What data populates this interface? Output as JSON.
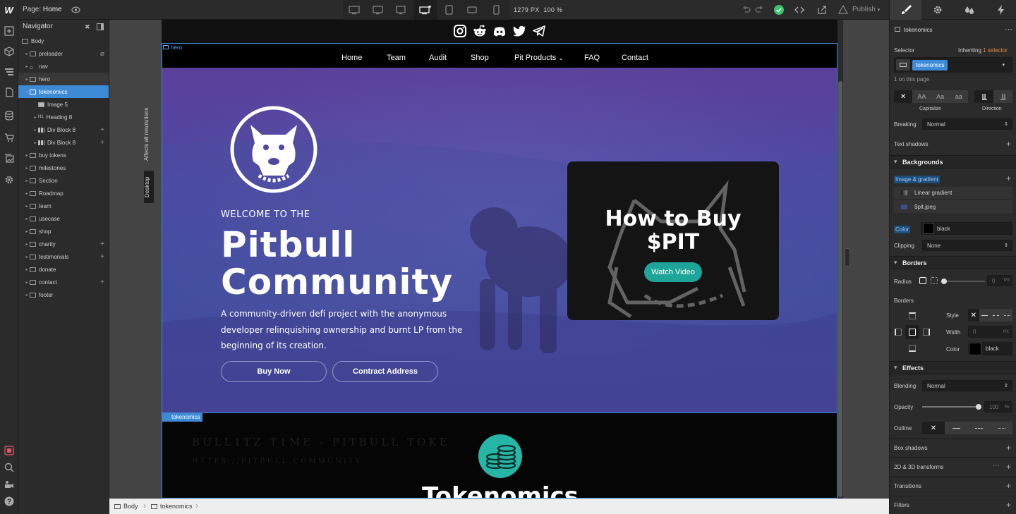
{
  "topbar": {
    "logo": "W",
    "page_prefix": "Page:",
    "page_name": "Home",
    "width_px": "1279 PX",
    "zoom": "100 %",
    "publish": "Publish"
  },
  "navigator": {
    "title": "Navigator",
    "items": [
      {
        "label": "Body",
        "depth": 0
      },
      {
        "label": "preloader",
        "depth": 1
      },
      {
        "label": "nav",
        "depth": 1
      },
      {
        "label": "hero",
        "depth": 1
      },
      {
        "label": "tokenomics",
        "depth": 1
      },
      {
        "label": "Image 5",
        "depth": 2
      },
      {
        "label": "Heading 8",
        "depth": 2
      },
      {
        "label": "Div Block 8",
        "depth": 2
      },
      {
        "label": "Div Block 8",
        "depth": 2
      },
      {
        "label": "buy tokens",
        "depth": 1
      },
      {
        "label": "milestones",
        "depth": 1
      },
      {
        "label": "Section",
        "depth": 1
      },
      {
        "label": "Roadmap",
        "depth": 1
      },
      {
        "label": "team",
        "depth": 1
      },
      {
        "label": "usecase",
        "depth": 1
      },
      {
        "label": "shop",
        "depth": 1
      },
      {
        "label": "charity",
        "depth": 1
      },
      {
        "label": "testimonials",
        "depth": 1
      },
      {
        "label": "donate",
        "depth": 1
      },
      {
        "label": "contact",
        "depth": 1
      },
      {
        "label": "footer",
        "depth": 1
      }
    ]
  },
  "canvas": {
    "affects_label": "Affects all resolutions",
    "breakpoint_label": "Desktop",
    "hero_tag": "hero",
    "tokenomics_tag": "tokenomics",
    "menu": [
      "Home",
      "Team",
      "Audit",
      "Shop",
      "Pit Products",
      "FAQ",
      "Contact"
    ],
    "hero": {
      "welcome": "WELCOME TO THE",
      "title_line1": "Pitbull",
      "title_line2": "Community",
      "description": "A community-driven defi project with the anonymous developer relinquishing ownership and burnt LP from the beginning of its creation.",
      "buy_button": "Buy Now",
      "contract_button": "Contract Address",
      "card_title_line1": "How to Buy",
      "card_title_line2": "$PIT",
      "watch_button": "Watch Video"
    },
    "tokenomics": {
      "marquee1": "BULL1TZ T1ME   -   PITBULL TOKE",
      "marquee2": "HTTPS://PITBULL.COMMUNITY",
      "title": "Tokenomics"
    }
  },
  "breadcrumbs": [
    "Body",
    "tokenomics"
  ],
  "right_panel": {
    "element_name": "tokenomics",
    "selector_label": "Selector",
    "inheriting_prefix": "Inheriting",
    "inheriting_count": "1 selector",
    "selector_chip": "tokenomics",
    "on_page": "1 on this page",
    "capitalize_options": [
      "✕",
      "AA",
      "Aa",
      "aa"
    ],
    "capitalize_label": "Capitalize",
    "direction_label": "Direction",
    "breaking_label": "Breaking",
    "breaking_value": "Normal",
    "text_shadows": "Text shadows",
    "backgrounds_header": "Backgrounds",
    "image_gradient": "Image & gradient",
    "bg_layers": [
      "Linear gradient",
      "$pit.jpeg"
    ],
    "color_label": "Color",
    "color_value": "black",
    "clipping_label": "Clipping",
    "clipping_value": "None",
    "borders_header": "Borders",
    "radius_label": "Radius",
    "radius_value": "0",
    "radius_unit": "PX",
    "borders_label": "Borders",
    "style_label": "Style",
    "width_label": "Width",
    "width_value": "0",
    "width_unit": "PX",
    "border_color_label": "Color",
    "border_color_value": "black",
    "effects_header": "Effects",
    "blending_label": "Blending",
    "blending_value": "Normal",
    "opacity_label": "Opacity",
    "opacity_value": "100",
    "opacity_unit": "%",
    "outline_label": "Outline",
    "box_shadows": "Box shadows",
    "transforms": "2D & 3D transforms",
    "transitions": "Transitions",
    "filters": "Filters"
  },
  "colors": {
    "accent": "#3d8bd6",
    "teal": "#1ea59a",
    "panel": "#2b2b2b",
    "inheriting": "#f28b3c"
  },
  "icons": [
    "webflow-logo",
    "eye-icon",
    "desktop-icon",
    "tablet-icon",
    "mobile-icon",
    "undo-icon",
    "redo-icon",
    "check-icon",
    "code-icon",
    "export-icon",
    "publish-icon",
    "paintbrush-icon",
    "gear-icon",
    "drops-icon",
    "lightning-icon",
    "instagram-icon",
    "reddit-icon",
    "discord-icon",
    "twitter-icon",
    "telegram-icon",
    "pitbull-logo-icon",
    "coins-icon"
  ]
}
